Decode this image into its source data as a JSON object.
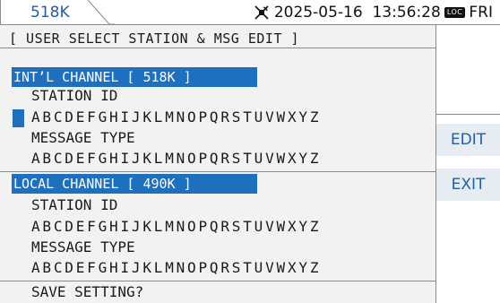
{
  "header": {
    "tab_label": "518K",
    "datetime": "2025-05-16  13:56:28",
    "loc_badge": "LOC",
    "weekday": "FRI",
    "gps_icon": "satellite-dish-icon"
  },
  "screen": {
    "title": "[ USER SELECT STATION & MSG EDIT ]",
    "intl": {
      "heading": "INT’L CHANNEL [ 518K ]",
      "station_label": "STATION ID",
      "station_value": "ABCDEFGHIJKLMNOPQRSTUVWXYZ",
      "message_label": "MESSAGE TYPE",
      "message_value": "ABCDEFGHIJKLMNOPQRSTUVWXYZ"
    },
    "local": {
      "heading": "LOCAL CHANNEL [ 490K ]",
      "station_label": "STATION ID",
      "station_value": "ABCDEFGHIJKLMNOPQRSTUVWXYZ",
      "message_label": "MESSAGE TYPE",
      "message_value": "ABCDEFGHIJKLMNOPQRSTUVWXYZ"
    },
    "save_prompt": "SAVE SETTING?"
  },
  "softkeys": {
    "edit": "EDIT",
    "exit": "EXIT"
  },
  "colors": {
    "accent": "#1f6fbf",
    "softkey_text": "#1f5fa8",
    "background": "#f2f2f2"
  }
}
